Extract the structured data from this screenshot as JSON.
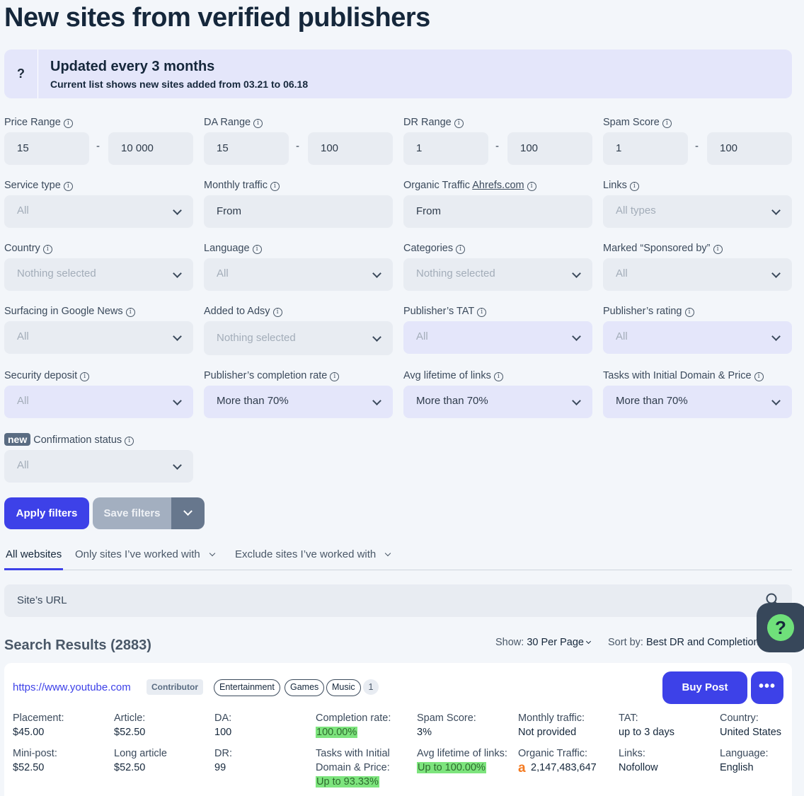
{
  "page_title": "New sites from verified publishers",
  "banner": {
    "icon": "?",
    "title": "Updated every 3 months",
    "subtitle": "Current list shows new sites added from 03.21 to 06.18"
  },
  "filters": {
    "price_range": {
      "label": "Price Range",
      "min": "15",
      "max": "10 000"
    },
    "da_range": {
      "label": "DA Range",
      "min": "15",
      "max": "100"
    },
    "dr_range": {
      "label": "DR Range",
      "min": "1",
      "max": "100"
    },
    "spam_score": {
      "label": "Spam Score",
      "min": "1",
      "max": "100"
    },
    "dash": "-",
    "service_type": {
      "label": "Service type",
      "value": "All"
    },
    "monthly_traffic": {
      "label": "Monthly traffic",
      "value": "From"
    },
    "organic_traffic": {
      "label": "Organic Traffic",
      "link": "Ahrefs.com",
      "value": "From"
    },
    "links": {
      "label": "Links",
      "value": "All types"
    },
    "country": {
      "label": "Country",
      "value": "Nothing selected"
    },
    "language": {
      "label": "Language",
      "value": "All"
    },
    "categories": {
      "label": "Categories",
      "value": "Nothing selected"
    },
    "sponsored": {
      "label": "Marked “Sponsored by”",
      "value": "All"
    },
    "google_news": {
      "label": "Surfacing in Google News",
      "value": "All"
    },
    "added_to_adsy": {
      "label": "Added to Adsy",
      "value": "Nothing selected"
    },
    "publisher_tat": {
      "label": "Publisher’s TAT",
      "value": "All"
    },
    "publisher_rating": {
      "label": "Publisher’s rating",
      "value": "All"
    },
    "security_deposit": {
      "label": "Security deposit",
      "value": "All"
    },
    "completion_rate": {
      "label": "Publisher’s completion rate",
      "value": "More than 70%"
    },
    "avg_lifetime": {
      "label": "Avg lifetime of links",
      "value": "More than 70%"
    },
    "initial_domain": {
      "label": "Tasks with Initial Domain & Price",
      "value": "More than 70%"
    },
    "confirmation": {
      "badge": "new",
      "label": "Confirmation status",
      "value": "All"
    }
  },
  "buttons": {
    "apply": "Apply filters",
    "save": "Save filters",
    "buy": "Buy Post",
    "more": "•••"
  },
  "tabs": {
    "all": "All websites",
    "only": "Only sites I’ve worked with",
    "exclude": "Exclude sites I’ve worked with"
  },
  "search": {
    "placeholder": "Site’s URL"
  },
  "results": {
    "title": "Search Results (2883)",
    "show_label": "Show:",
    "show_value": "30 Per Page",
    "sort_label": "Sort by:",
    "sort_value": "Best DR and Completion rate"
  },
  "card": {
    "url": "https://www.youtube.com",
    "role": "Contributor",
    "categories": [
      "Entertainment",
      "Games",
      "Music"
    ],
    "extra_count": "1",
    "metrics": {
      "placement_l": "Placement:",
      "placement_v": "$45.00",
      "article_l": "Article:",
      "article_v": "$52.50",
      "da_l": "DA:",
      "da_v": "100",
      "completion_l": "Completion rate:",
      "completion_v": "100.00%",
      "spam_l": "Spam Score:",
      "spam_v": "3%",
      "monthly_l": "Monthly traffic:",
      "monthly_v": "Not provided",
      "tat_l": "TAT:",
      "tat_v": "up to 3 days",
      "country_l": "Country:",
      "country_v": "United States",
      "mini_l": "Mini-post:",
      "mini_v": "$52.50",
      "long_l": "Long article",
      "long_v": "$52.50",
      "dr_l": "DR:",
      "dr_v": "99",
      "initial_l1": "Tasks with Initial",
      "initial_l2": "Domain & Price:",
      "initial_v": "Up to 93.33%",
      "lifetime_l": "Avg lifetime of links:",
      "lifetime_v": "Up to 100.00%",
      "organic_l": "Organic Traffic:",
      "organic_v": "2,147,483,647",
      "links_l": "Links:",
      "links_v": "Nofollow",
      "language_l": "Language:",
      "language_v": "English"
    }
  },
  "colors": {
    "accent": "#3d41e8",
    "banner": "#e4e6fa",
    "highlight": "#7de47d",
    "help": "#6fe07a"
  },
  "icons": [
    "info-icon",
    "chevron-down-icon",
    "search-icon",
    "help-icon",
    "ahrefs-icon",
    "more-icon"
  ]
}
